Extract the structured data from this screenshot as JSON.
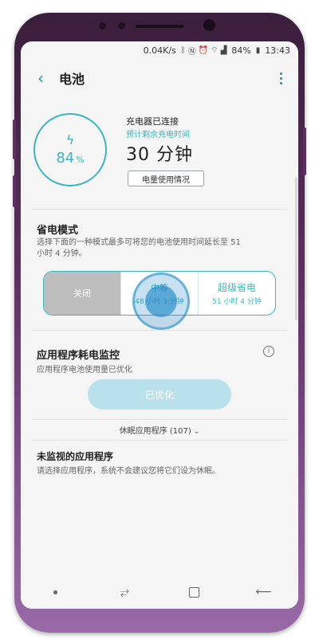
{
  "status_bar": {
    "network_speed": "0.04K/s",
    "icons": [
      "bluetooth-icon",
      "nfc-icon",
      "alarm-icon",
      "wifi-icon",
      "signal-icon",
      "battery-icon"
    ],
    "battery": "84%",
    "time": "13:43"
  },
  "app_bar": {
    "title": "电池"
  },
  "battery_card": {
    "percent_value": "84",
    "percent_unit": "%",
    "charge_status": "充电器已连接",
    "remaining_label": "预计剩余充电时间",
    "remaining_time": "30 分钟",
    "usage_button": "电量使用情况"
  },
  "power_mode": {
    "title": "省电模式",
    "description": "选择下面的一种模式最多可将您的电池使用时间延长至 51 小时 4 分钟。",
    "options": [
      {
        "label": "关闭",
        "sub": ""
      },
      {
        "label": "中等",
        "sub": "48 小时 3 分钟"
      },
      {
        "label": "超级省电",
        "sub": "51 小时 4 分钟"
      }
    ]
  },
  "app_monitor": {
    "title": "应用程序耗电监控",
    "description": "应用程序电池使用量已优化",
    "button": "已优化"
  },
  "sleep_apps": {
    "label": "休眠应用程序 (107)"
  },
  "unmonitored": {
    "title": "未监视的应用程序",
    "description": "请选择应用程序，系统不会建议您将它们设为休眠。"
  },
  "colors": {
    "accent": "#3ab5bf",
    "tap_highlight": "#1e88c8",
    "frame": "#5a2f5c"
  }
}
